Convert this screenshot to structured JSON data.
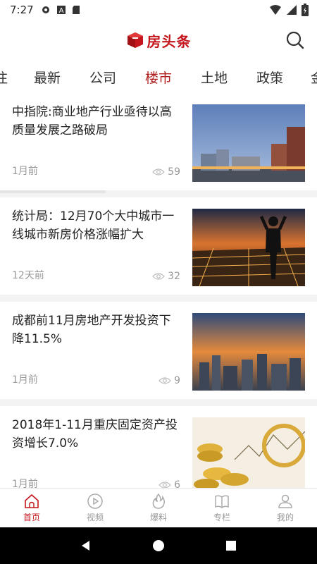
{
  "status_bar": {
    "time": "7:27"
  },
  "header": {
    "logo_text": "房头条",
    "brand_color": "#c4161c"
  },
  "tabs": [
    {
      "label": "注"
    },
    {
      "label": "最新"
    },
    {
      "label": "公司"
    },
    {
      "label": "楼市",
      "active": true
    },
    {
      "label": "土地"
    },
    {
      "label": "政策"
    },
    {
      "label": "金"
    }
  ],
  "articles": [
    {
      "title": "中指院:商业地产行业亟待以高质量发展之路破局",
      "time": "1月前",
      "views": "59"
    },
    {
      "title": "统计局：12月70个大中城市一线城市新房价格涨幅扩大",
      "time": "12天前",
      "views": "32"
    },
    {
      "title": "成都前11月房地产开发投资下降11.5%",
      "time": "1月前",
      "views": "9"
    },
    {
      "title": "2018年1-11月重庆固定资产投资增长7.0%",
      "time": "1月前",
      "views": "6"
    }
  ],
  "bottom_nav": [
    {
      "label": "首页",
      "icon": "home-icon",
      "active": true
    },
    {
      "label": "视频",
      "icon": "play-icon"
    },
    {
      "label": "爆料",
      "icon": "fire-icon"
    },
    {
      "label": "专栏",
      "icon": "book-icon"
    },
    {
      "label": "我的",
      "icon": "user-icon"
    }
  ]
}
